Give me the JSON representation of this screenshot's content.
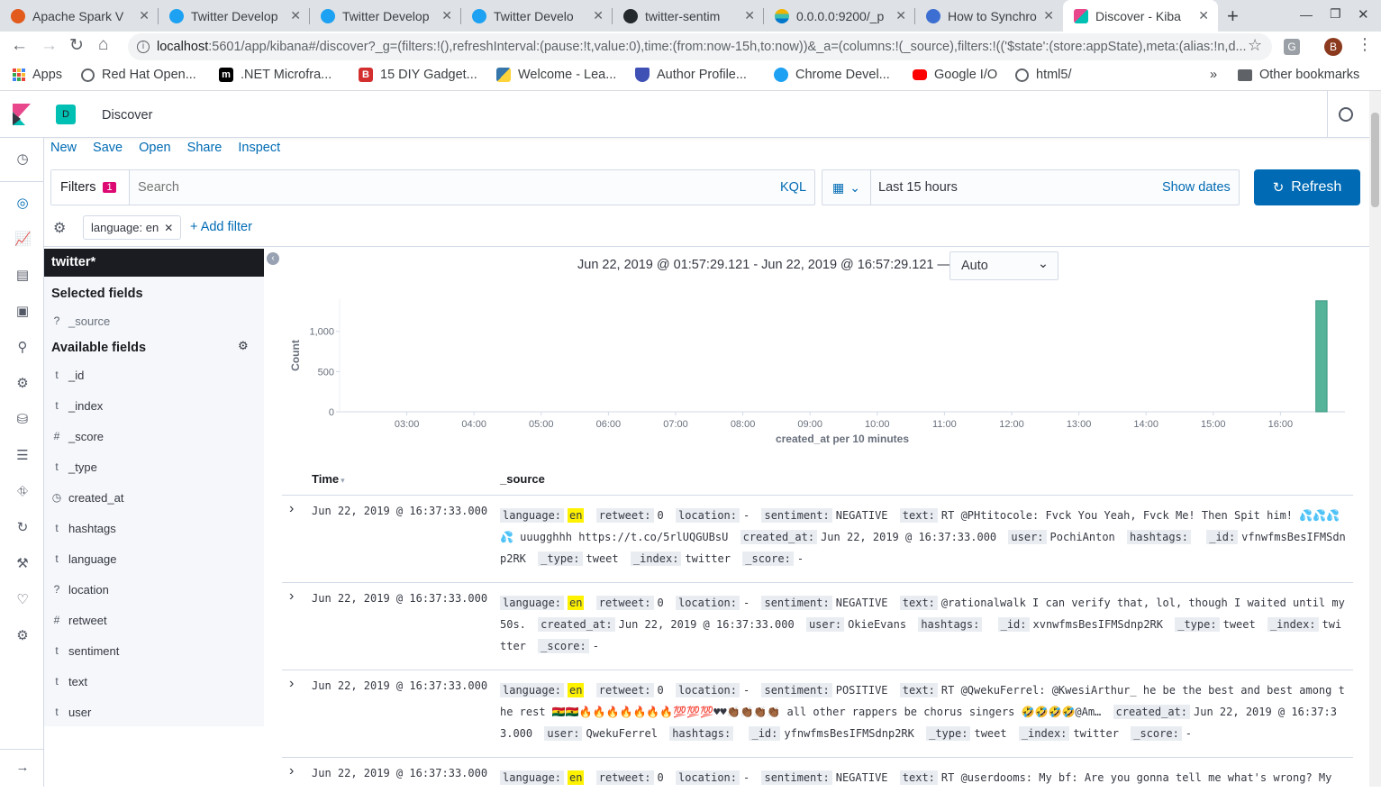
{
  "browser": {
    "tabs": [
      {
        "title": "Apache Spark V",
        "favicon_color": "#e25a1c"
      },
      {
        "title": "Twitter Develop",
        "favicon_color": "#1da1f2"
      },
      {
        "title": "Twitter Develop",
        "favicon_color": "#1da1f2"
      },
      {
        "title": "Twitter Develo",
        "favicon_color": "#1da1f2"
      },
      {
        "title": "twitter-sentim",
        "favicon_color": "#24292e"
      },
      {
        "title": "0.0.0.0:9200/_p",
        "favicon_color": "#f0b400"
      },
      {
        "title": "How to Synchro",
        "favicon_color": "#3c6fd1"
      },
      {
        "title": "Discover - Kiba",
        "favicon_color": "#e8488b"
      }
    ],
    "url_host": "localhost",
    "url_rest": ":5601/app/kibana#/discover?_g=(filters:!(),refreshInterval:(pause:!t,value:0),time:(from:now-15h,to:now))&_a=(columns:!(_source),filters:!(('$state':(store:appState),meta:(alias:!n,d...",
    "bookmarks": [
      {
        "label": "Apps"
      },
      {
        "label": "Red Hat Open..."
      },
      {
        "label": ".NET Microfra..."
      },
      {
        "label": "15 DIY Gadget..."
      },
      {
        "label": "Welcome - Lea..."
      },
      {
        "label": "Author Profile..."
      },
      {
        "label": "Chrome Devel..."
      },
      {
        "label": "Google I/O"
      },
      {
        "label": "html5/"
      }
    ],
    "bookmarks_more": "»",
    "other_bookmarks": "Other bookmarks",
    "profile_letter": "B"
  },
  "kibana": {
    "space_letter": "D",
    "page_title": "Discover",
    "menu": [
      "New",
      "Save",
      "Open",
      "Share",
      "Inspect"
    ],
    "filters_label": "Filters",
    "filters_count": "1",
    "search_placeholder": "Search",
    "kql_label": "KQL",
    "date_range": "Last 15 hours",
    "show_dates": "Show dates",
    "refresh_label": "Refresh",
    "filter_pill": "language: en",
    "add_filter": "+ Add filter",
    "index_pattern": "twitter*",
    "selected_fields_title": "Selected fields",
    "selected_fields": [
      {
        "type": "?",
        "name": "_source"
      }
    ],
    "available_fields_title": "Available fields",
    "available_fields": [
      {
        "type": "t",
        "name": "_id"
      },
      {
        "type": "t",
        "name": "_index"
      },
      {
        "type": "#",
        "name": "_score"
      },
      {
        "type": "t",
        "name": "_type"
      },
      {
        "type": "clock",
        "name": "created_at"
      },
      {
        "type": "t",
        "name": "hashtags"
      },
      {
        "type": "t",
        "name": "language"
      },
      {
        "type": "?",
        "name": "location"
      },
      {
        "type": "#",
        "name": "retweet"
      },
      {
        "type": "t",
        "name": "sentiment"
      },
      {
        "type": "t",
        "name": "text"
      },
      {
        "type": "t",
        "name": "user"
      }
    ],
    "time_range_text": "Jun 22, 2019 @ 01:57:29.121 - Jun 22, 2019 @ 16:57:29.121 —",
    "interval": "Auto",
    "table_headers": {
      "time": "Time",
      "source": "_source"
    }
  },
  "chart_data": {
    "type": "bar",
    "xlabel": "created_at per 10 minutes",
    "ylabel": "Count",
    "y_ticks": [
      "0",
      "500",
      "1,000"
    ],
    "ylim": [
      0,
      1400
    ],
    "x_ticks": [
      "03:00",
      "04:00",
      "05:00",
      "06:00",
      "07:00",
      "08:00",
      "09:00",
      "10:00",
      "11:00",
      "12:00",
      "13:00",
      "14:00",
      "15:00",
      "16:00"
    ],
    "x_range_hours": [
      2.0,
      16.96
    ],
    "bars": [
      {
        "x_hour": 16.5,
        "value": 1380
      }
    ],
    "bar_color": "#54b399"
  },
  "documents": [
    {
      "time": "Jun 22, 2019 @ 16:37:33.000",
      "language": "en",
      "retweet": "0",
      "location": "-",
      "sentiment": "NEGATIVE",
      "text": "RT @PHtitocole: Fvck You Yeah, Fvck Me! Then Spit him! 💦💦💦💦 uuugghhh https://t.co/5rlUQGUBsU",
      "created_at": "Jun 22, 2019 @ 16:37:33.000",
      "user": "PochiAnton",
      "hashtags": "",
      "_id": "vfnwfmsBesIFMSdnp2RK",
      "_type": "tweet",
      "_index": "twitter",
      "_score": "-"
    },
    {
      "time": "Jun 22, 2019 @ 16:37:33.000",
      "language": "en",
      "retweet": "0",
      "location": "-",
      "sentiment": "NEGATIVE",
      "text": "@rationalwalk I can verify that, lol, though I waited until my 50s.",
      "created_at": "Jun 22, 2019 @ 16:37:33.000",
      "user": "OkieEvans",
      "hashtags": "",
      "_id": "xvnwfmsBesIFMSdnp2RK",
      "_type": "tweet",
      "_index": "twitter",
      "_score": "-"
    },
    {
      "time": "Jun 22, 2019 @ 16:37:33.000",
      "language": "en",
      "retweet": "0",
      "location": "-",
      "sentiment": "POSITIVE",
      "text": "RT @QwekuFerrel: @KwesiArthur_ he be the best and best among the rest 🇬🇭🇬🇭🔥🔥🔥🔥🔥🔥🔥💯💯💯♥♥👏🏾👏🏾👏🏾👏🏾 all other rappers be chorus singers 🤣🤣🤣🤣@Am…",
      "created_at": "Jun 22, 2019 @ 16:37:33.000",
      "user": "QwekuFerrel",
      "hashtags": "",
      "_id": "yfnwfmsBesIFMSdnp2RK",
      "_type": "tweet",
      "_index": "twitter",
      "_score": "-"
    },
    {
      "time": "Jun 22, 2019 @ 16:37:33.000",
      "language": "en",
      "retweet": "0",
      "location": "-",
      "sentiment": "NEGATIVE",
      "text": "RT @userdooms: My bf: Are you gonna tell me what's wrong? My",
      "created_at": "",
      "user": "",
      "hashtags": "",
      "_id": "",
      "_type": "",
      "_index": "",
      "_score": ""
    }
  ]
}
